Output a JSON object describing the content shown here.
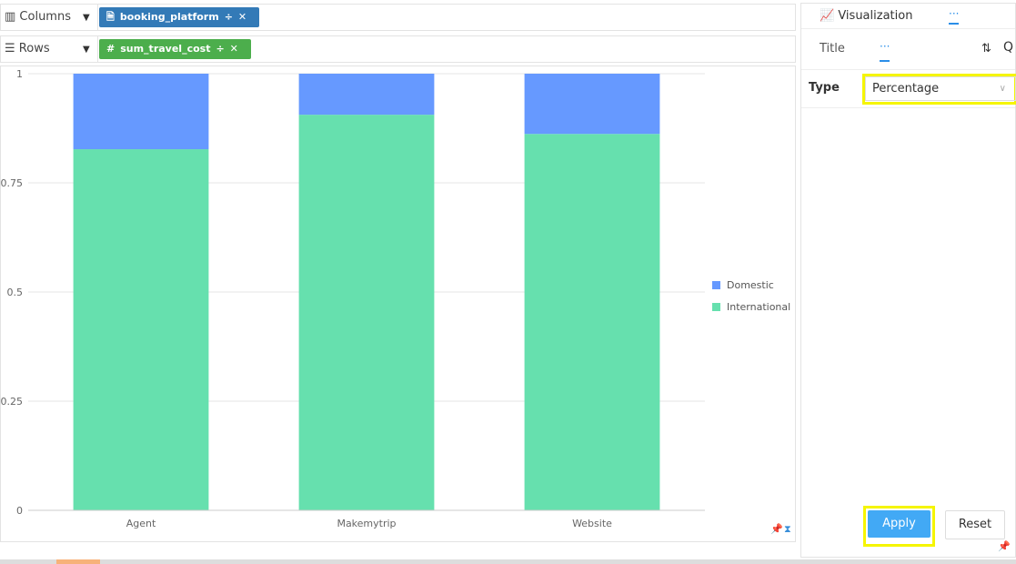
{
  "shelves": {
    "columns": {
      "label": "Columns",
      "pill": "booking_platform",
      "color": "#337ab7"
    },
    "rows": {
      "label": "Rows",
      "pill": "sum_travel_cost",
      "color": "#4cae4c"
    }
  },
  "panel": {
    "tab_visualization": "Visualization",
    "tab_more": "···",
    "sub_title": "Title",
    "sub_more": "···",
    "type_label": "Type",
    "type_value": "Percentage",
    "apply": "Apply",
    "reset": "Reset"
  },
  "chart_data": {
    "type": "bar",
    "stacked": true,
    "categories": [
      "Agent",
      "Makemytrip",
      "Website"
    ],
    "series": [
      {
        "name": "International",
        "values": [
          0.827,
          0.906,
          0.862
        ],
        "color": "#66e0ae"
      },
      {
        "name": "Domestic",
        "values": [
          0.173,
          0.094,
          0.138
        ],
        "color": "#6699ff"
      }
    ],
    "yticks": [
      "0",
      "0.25",
      "0.5",
      "0.75",
      "1"
    ],
    "ylim": [
      0,
      1
    ],
    "grid": true,
    "legend": "right"
  }
}
